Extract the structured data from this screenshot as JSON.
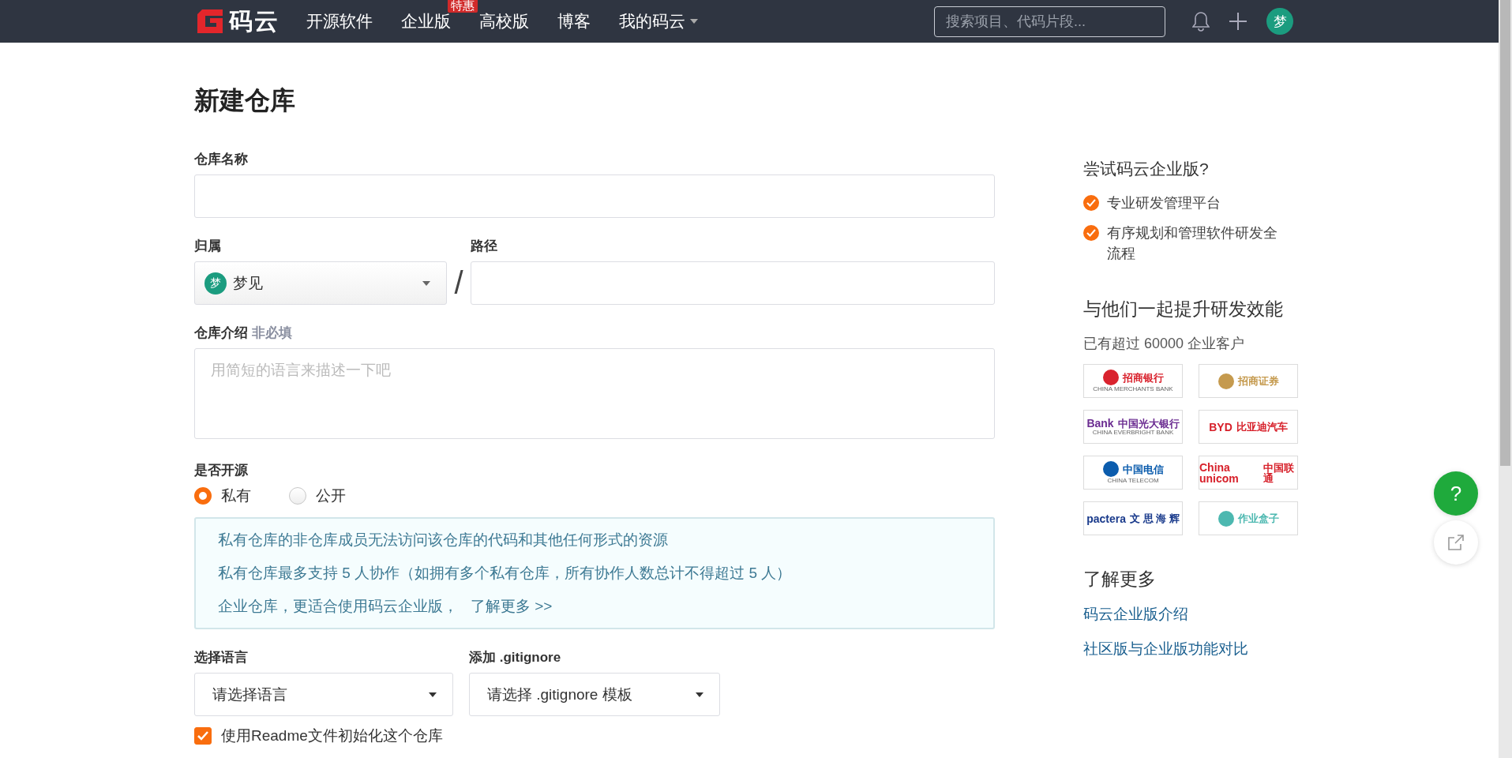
{
  "header": {
    "logo": "码云",
    "nav": [
      {
        "label": "开源软件",
        "dropdown": false
      },
      {
        "label": "企业版",
        "badge": "特惠",
        "dropdown": false
      },
      {
        "label": "高校版",
        "dropdown": false
      },
      {
        "label": "博客",
        "dropdown": false
      },
      {
        "label": "我的码云",
        "dropdown": true
      }
    ],
    "search": {
      "placeholder": "搜索项目、代码片段..."
    },
    "avatar": "梦"
  },
  "title": "新建仓库",
  "form": {
    "name": {
      "label": "仓库名称"
    },
    "owner": {
      "label": "归属",
      "avatar": "梦",
      "value": "梦见"
    },
    "separator": "/",
    "path": {
      "label": "路径"
    },
    "description": {
      "label": "仓库介绍",
      "optional": "非必填",
      "placeholder": "用简短的语言来描述一下吧"
    },
    "visibility": {
      "label": "是否开源",
      "options": [
        {
          "label": "私有",
          "selected": true
        },
        {
          "label": "公开",
          "selected": false
        }
      ]
    },
    "notice": [
      {
        "text": "私有仓库的非仓库成员无法访问该仓库的代码和其他任何形式的资源"
      },
      {
        "text": "私有仓库最多支持 5 人协作（如拥有多个私有仓库，所有协作人数总计不得超过 5 人）"
      },
      {
        "text": "企业仓库，更适合使用码云企业版，",
        "link": "了解更多 >>"
      }
    ],
    "language": {
      "label": "选择语言",
      "value": "请选择语言"
    },
    "gitignore": {
      "label": "添加 .gitignore",
      "value": "请选择 .gitignore 模板"
    },
    "readme": {
      "label": "使用Readme文件初始化这个仓库",
      "checked": true
    }
  },
  "sidebar": {
    "promo_title": "尝试码云企业版?",
    "features": [
      "专业研发管理平台",
      "有序规划和管理软件研发全流程"
    ],
    "customers_title": "与他们一起提升研发效能",
    "customers_count": "已有超过 60000 企业客户",
    "customers": [
      {
        "name": "招商银行",
        "sub": "CHINA MERCHANTS BANK",
        "color": "#d9232e"
      },
      {
        "name": "招商证券",
        "color": "#c59a4e"
      },
      {
        "mark": "Bank",
        "name": "中国光大银行",
        "sub": "CHINA EVERBRIGHT BANK",
        "color": "#6b2c91"
      },
      {
        "mark": "BYD",
        "name": "比亚迪汽车",
        "color": "#d7202a"
      },
      {
        "name": "中国电信",
        "sub": "CHINA TELECOM",
        "color": "#0b5cad"
      },
      {
        "mark": "China unicom",
        "name": "中国联通",
        "color": "#d7202a"
      },
      {
        "mark": "pactera",
        "name": "文 思 海 辉",
        "color": "#1a3b8c"
      },
      {
        "name": "作业盒子",
        "color": "#4cb8b0"
      }
    ],
    "more_title": "了解更多",
    "links": [
      "码云企业版介绍",
      "社区版与企业版功能对比"
    ]
  },
  "float": {
    "help": "?"
  }
}
